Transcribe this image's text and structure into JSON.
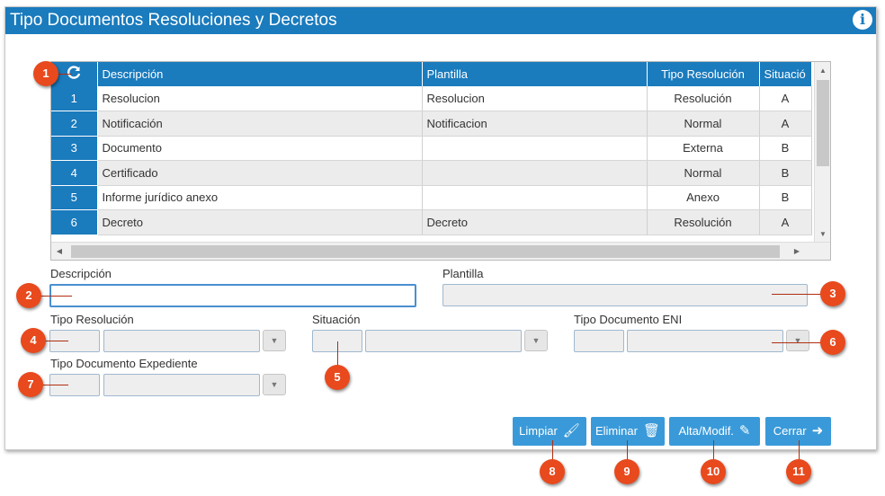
{
  "window": {
    "title": "Tipo Documentos Resoluciones y Decretos",
    "info_icon": "info-icon"
  },
  "grid": {
    "refresh_icon": "refresh-icon",
    "columns": [
      "Descripción",
      "Plantilla",
      "Tipo Resolución",
      "Situació"
    ],
    "rows": [
      {
        "num": "1",
        "descripcion": "Resolucion",
        "plantilla": "Resolucion",
        "tipo": "Resolución",
        "situacion": "A"
      },
      {
        "num": "2",
        "descripcion": "Notificación",
        "plantilla": "Notificacion",
        "tipo": "Normal",
        "situacion": "A"
      },
      {
        "num": "3",
        "descripcion": "Documento",
        "plantilla": "",
        "tipo": "Externa",
        "situacion": "B"
      },
      {
        "num": "4",
        "descripcion": "Certificado",
        "plantilla": "",
        "tipo": "Normal",
        "situacion": "B"
      },
      {
        "num": "5",
        "descripcion": "Informe jurídico anexo",
        "plantilla": "",
        "tipo": "Anexo",
        "situacion": "B"
      },
      {
        "num": "6",
        "descripcion": "Decreto",
        "plantilla": "Decreto",
        "tipo": "Resolución",
        "situacion": "A"
      }
    ]
  },
  "form": {
    "descripcion_label": "Descripción",
    "descripcion_value": "",
    "plantilla_label": "Plantilla",
    "plantilla_value": "",
    "tipo_resolucion_label": "Tipo Resolución",
    "situacion_label": "Situación",
    "tipo_documento_eni_label": "Tipo Documento ENI",
    "tipo_documento_expediente_label": "Tipo Documento Expediente"
  },
  "buttons": {
    "limpiar": "Limpiar",
    "eliminar": "Eliminar",
    "alta_modif": "Alta/Modif.",
    "cerrar": "Cerrar"
  },
  "callouts": [
    "1",
    "2",
    "3",
    "4",
    "5",
    "6",
    "7",
    "8",
    "9",
    "10",
    "11"
  ],
  "colors": {
    "accent": "#1a7bbd",
    "button": "#3a9ad9",
    "callout": "#e8491d"
  }
}
